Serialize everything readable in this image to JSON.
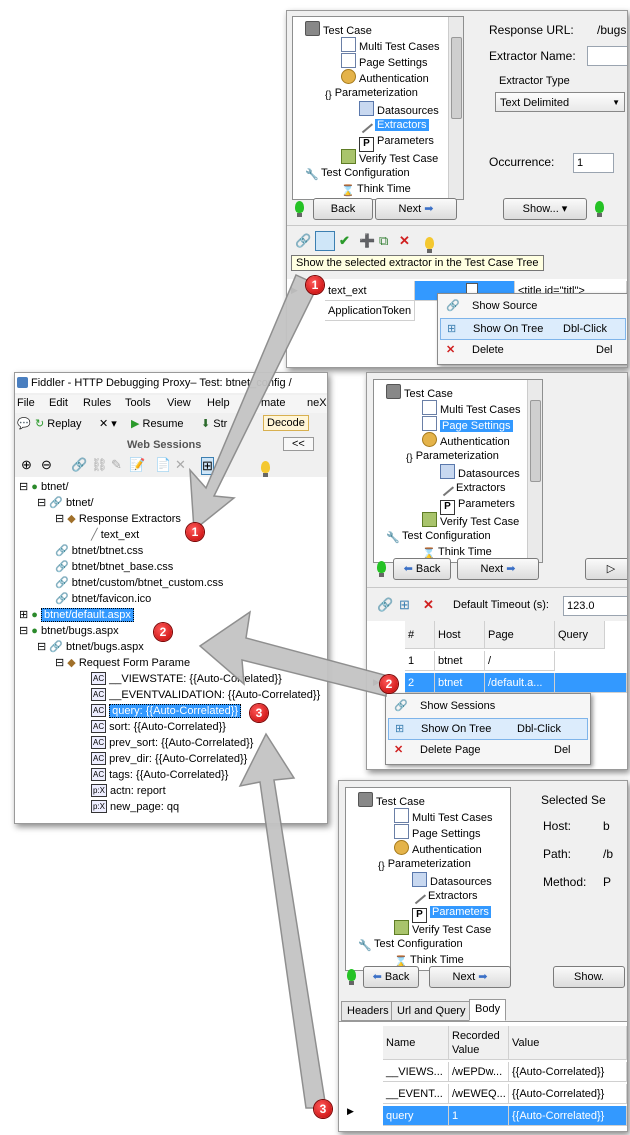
{
  "panel1": {
    "tree": [
      "Test Case",
      "Multi Test Cases",
      "Page Settings",
      "Authentication",
      "Parameterization",
      "Datasources",
      "Extractors",
      "Parameters",
      "Verify Test Case",
      "Test Configuration",
      "Think Time"
    ],
    "response_url_label": "Response URL:",
    "response_url_value": "/bugs",
    "extractor_name_label": "Extractor Name:",
    "extractor_type_label": "Extractor Type",
    "extractor_type_value": "Text Delimited",
    "occurrence_label": "Occurrence:",
    "occurrence_value": "1",
    "back": "Back",
    "next": "Next",
    "show": "Show...",
    "tooltip": "Show the selected extractor in the Test Case Tree",
    "row1_name": "text_ext",
    "row1_value": "<title id=\"titl\">",
    "row2_name": "ApplicationToken",
    "menu": [
      {
        "label": "Show Source",
        "shortcut": ""
      },
      {
        "label": "Show On Tree",
        "shortcut": "Dbl-Click"
      },
      {
        "label": "Delete",
        "shortcut": "Del"
      }
    ]
  },
  "fiddler": {
    "title": "Fiddler - HTTP Debugging Proxy– Test: btnet_config /",
    "menu": [
      "File",
      "Edit",
      "Rules",
      "Tools",
      "View",
      "Help",
      "mate",
      "neX"
    ],
    "replay": "Replay",
    "resume": "Resume",
    "stream": "Str",
    "decode": "Decode",
    "web_sessions": "Web Sessions",
    "collapse": "<<",
    "tree": {
      "btnet": "btnet/",
      "btnet2": "btnet/",
      "response_extractors": "Response Extractors",
      "text_ext": "text_ext",
      "btnet_css": "btnet/btnet.css",
      "btnet_base_css": "btnet/btnet_base.css",
      "btnet_custom_css": "btnet/custom/btnet_custom.css",
      "favicon": "btnet/favicon.ico",
      "default_aspx": "btnet/default.aspx",
      "bugs_aspx": "btnet/bugs.aspx",
      "bugs_aspx2": "btnet/bugs.aspx",
      "request_form_params": "Request Form Parame",
      "params": [
        {
          "tag": "AC",
          "text": "__VIEWSTATE: {{Auto-Correlated}}"
        },
        {
          "tag": "AC",
          "text": "__EVENTVALIDATION: {{Auto-Correlated}}"
        },
        {
          "tag": "AC",
          "text": "query: {{Auto-Correlated}}"
        },
        {
          "tag": "AC",
          "text": "sort: {{Auto-Correlated}}"
        },
        {
          "tag": "AC",
          "text": "prev_sort: {{Auto-Correlated}}"
        },
        {
          "tag": "AC",
          "text": "prev_dir: {{Auto-Correlated}}"
        },
        {
          "tag": "AC",
          "text": "tags: {{Auto-Correlated}}"
        },
        {
          "tag": "p:X",
          "text": "actn: report"
        },
        {
          "tag": "p:X",
          "text": "new_page: qq"
        }
      ]
    }
  },
  "panel2": {
    "tree": [
      "Test Case",
      "Multi Test Cases",
      "Page Settings",
      "Authentication",
      "Parameterization",
      "Datasources",
      "Extractors",
      "Parameters",
      "Verify Test Case",
      "Test Configuration",
      "Think Time"
    ],
    "back": "Back",
    "next": "Next",
    "timeout_label": "Default Timeout (s):",
    "timeout_value": "123.0",
    "columns": [
      "#",
      "Host",
      "Page",
      "Query"
    ],
    "rows": [
      {
        "num": "1",
        "host": "btnet",
        "page": "/"
      },
      {
        "num": "2",
        "host": "btnet",
        "page": "/default.a..."
      }
    ],
    "menu": [
      {
        "label": "Show Sessions",
        "shortcut": ""
      },
      {
        "label": "Show On Tree",
        "shortcut": "Dbl-Click"
      },
      {
        "label": "Delete Page",
        "shortcut": "Del"
      }
    ]
  },
  "panel3": {
    "tree": [
      "Test Case",
      "Multi Test Cases",
      "Page Settings",
      "Authentication",
      "Parameterization",
      "Datasources",
      "Extractors",
      "Parameters",
      "Verify Test Case",
      "Test Configuration",
      "Think Time"
    ],
    "selected_label": "Selected Se",
    "host_label": "Host:",
    "host_value": "b",
    "path_label": "Path:",
    "path_value": "/b",
    "method_label": "Method:",
    "method_value": "P",
    "back": "Back",
    "next": "Next",
    "show": "Show.",
    "tabs": [
      "Headers",
      "Url and Query",
      "Body"
    ],
    "columns": [
      "Name",
      "Recorded Value",
      "Value"
    ],
    "rows": [
      {
        "name": "__VIEWS...",
        "recorded": "/wEPDw...",
        "value": "{{Auto-Correlated}}"
      },
      {
        "name": "__EVENT...",
        "recorded": "/wEWEQ...",
        "value": "{{Auto-Correlated}}"
      },
      {
        "name": "query",
        "recorded": "1",
        "value": "{{Auto-Correlated}}"
      }
    ]
  },
  "markers": [
    "1",
    "1",
    "2",
    "2",
    "3",
    "3"
  ]
}
